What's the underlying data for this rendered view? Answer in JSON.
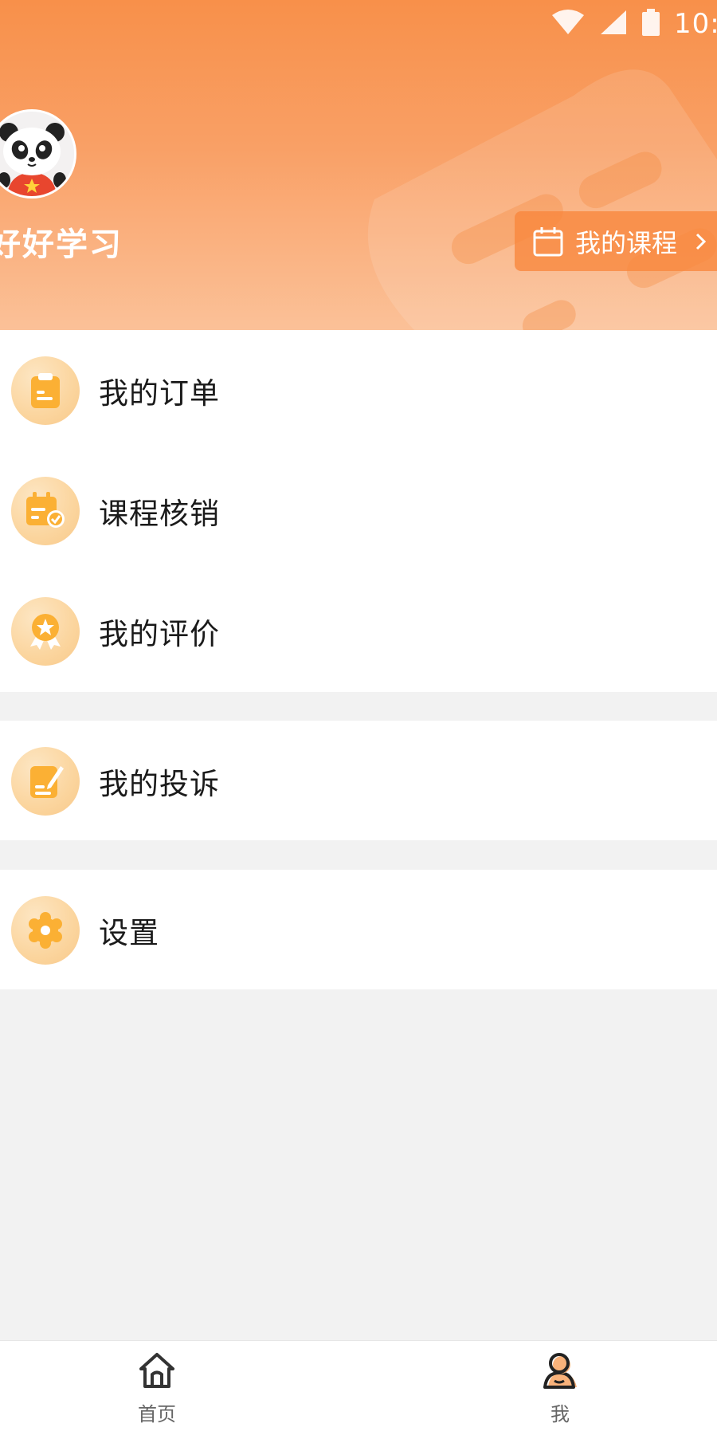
{
  "status_bar": {
    "time": "10:",
    "icons": [
      "wifi-icon",
      "signal-icon",
      "battery-icon"
    ]
  },
  "profile": {
    "username": "好好学习",
    "avatar": "panda-avatar"
  },
  "my_course_button": {
    "label": "我的课程",
    "icon": "calendar-icon"
  },
  "menu": {
    "group1": [
      {
        "label": "我的订单",
        "icon": "order-clipboard-icon"
      },
      {
        "label": "课程核销",
        "icon": "course-verify-icon"
      },
      {
        "label": "我的评价",
        "icon": "award-ribbon-icon"
      }
    ],
    "group2": [
      {
        "label": "我的投诉",
        "icon": "complaint-edit-icon"
      }
    ],
    "group3": [
      {
        "label": "设置",
        "icon": "settings-gear-icon"
      }
    ]
  },
  "bottom_nav": {
    "home_label": "首页",
    "me_label": "我",
    "active": "我"
  },
  "colors": {
    "header_top": "#f8904a",
    "header_bottom": "#fbc198",
    "accent": "#fbb034",
    "icon_bg": "#fbd59e",
    "page_bg": "#f2f2f2"
  }
}
